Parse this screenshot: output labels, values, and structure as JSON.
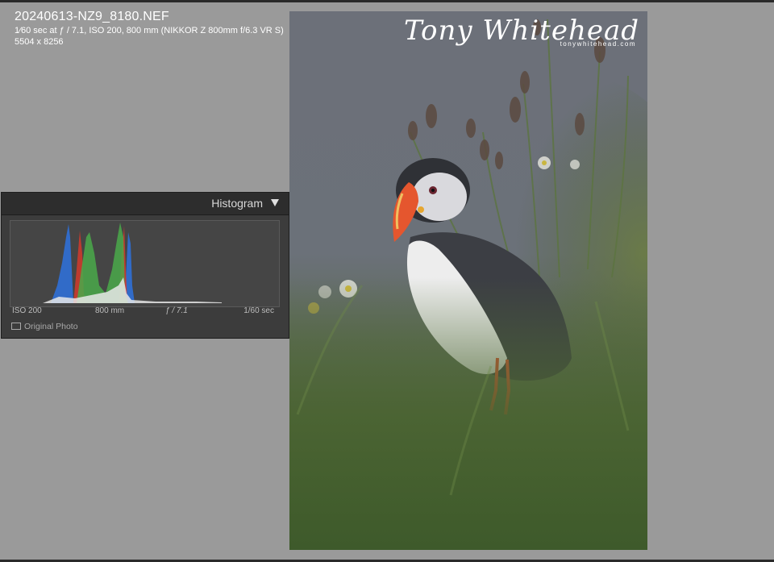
{
  "info": {
    "filename": "20240613-NZ9_8180.NEF",
    "exposure": "1⁄60 sec at ƒ / 7.1, ISO 200, 800 mm (NIKKOR Z 800mm f/6.3 VR S)",
    "dimensions": "5504 x 8256"
  },
  "watermark": {
    "signature": "Tony Whitehead",
    "url": "tonywhitehead.com"
  },
  "histogram": {
    "title": "Histogram",
    "iso": "ISO 200",
    "focal_length": "800 mm",
    "aperture": "ƒ / 7.1",
    "shutter": "1/60 sec",
    "original_photo_label": "Original Photo",
    "colors": {
      "blue": "#2f6fd6",
      "red": "#d23a2c",
      "green": "#4aa94a",
      "white": "#e8e8e8"
    }
  }
}
